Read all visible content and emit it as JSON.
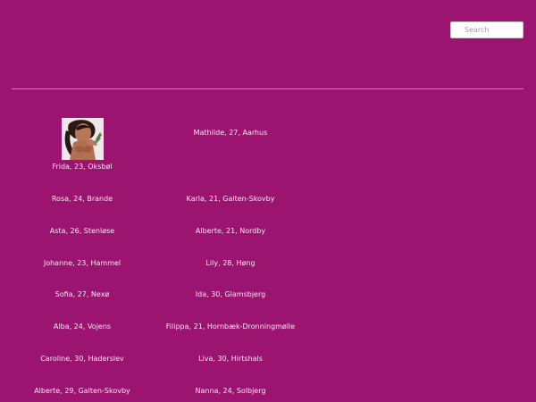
{
  "search": {
    "placeholder": "Search"
  },
  "profile_image": {
    "icon": "profile-photo"
  },
  "listings_left": [
    "Frida, 23, Oksbøl",
    "Rosa, 24, Brande",
    "Asta, 26, Stenløse",
    "Johanne, 23, Hammel",
    "Sofia, 27, Nexø",
    "Alba, 24, Vojens",
    "Caroline, 30, Haderslev",
    "Alberte, 29, Galten-Skovby"
  ],
  "listings_right": [
    "Mathilde, 27, Aarhus",
    "Karla, 21, Galten-Skovby",
    "Alberte, 21, Nordby",
    "Lily, 28, Høng",
    "Ida, 30, Glamsbjerg",
    "Filippa, 21, Hornbæk-Dronningmølle",
    "Liva, 30, Hirtshals",
    "Nanna, 24, Solbjerg"
  ]
}
